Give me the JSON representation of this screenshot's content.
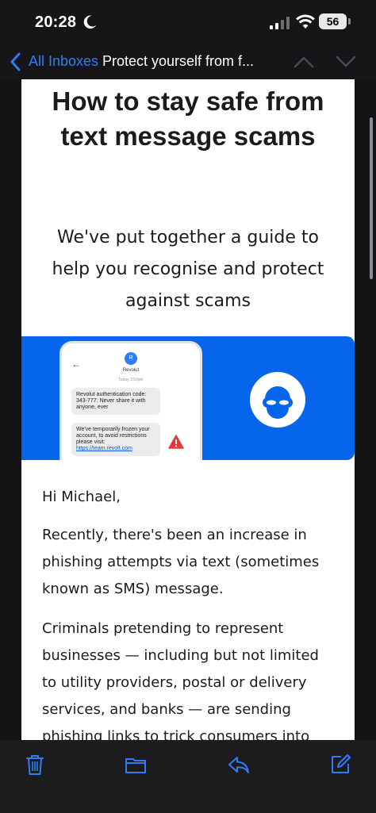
{
  "status_bar": {
    "time": "20:28",
    "battery": "56"
  },
  "nav": {
    "back_label": "All Inboxes",
    "title": "Protect yourself from f..."
  },
  "email": {
    "headline": "How to stay safe from text message scams",
    "subhead": "We've put together a guide to help you recognise and protect against scams",
    "banner": {
      "avatar_letter": "R",
      "sender": "Revolut",
      "time": "Today 3:50pm",
      "message1": "Revolut authentication code: 343-777. Never share it with anyone, ever",
      "message2": "We've temporarily frozen your account, to avoid restrictions please visit:",
      "message2_link": "https://team.revolt.com"
    },
    "greeting": "Hi Michael,",
    "paragraph1": "Recently, there's been an increase in phishing attempts via text (sometimes known as SMS) message.",
    "paragraph2": "Criminals pretending to represent businesses — including but not limited to utility providers, postal or delivery services, and banks — are sending phishing links to trick consumers into"
  },
  "toolbar": {
    "icons": [
      "trash-icon",
      "folder-icon",
      "reply-icon",
      "compose-icon"
    ]
  },
  "colors": {
    "accent": "#2f7cf6",
    "banner_blue": "#0666eb",
    "warning_red": "#e5383b"
  }
}
